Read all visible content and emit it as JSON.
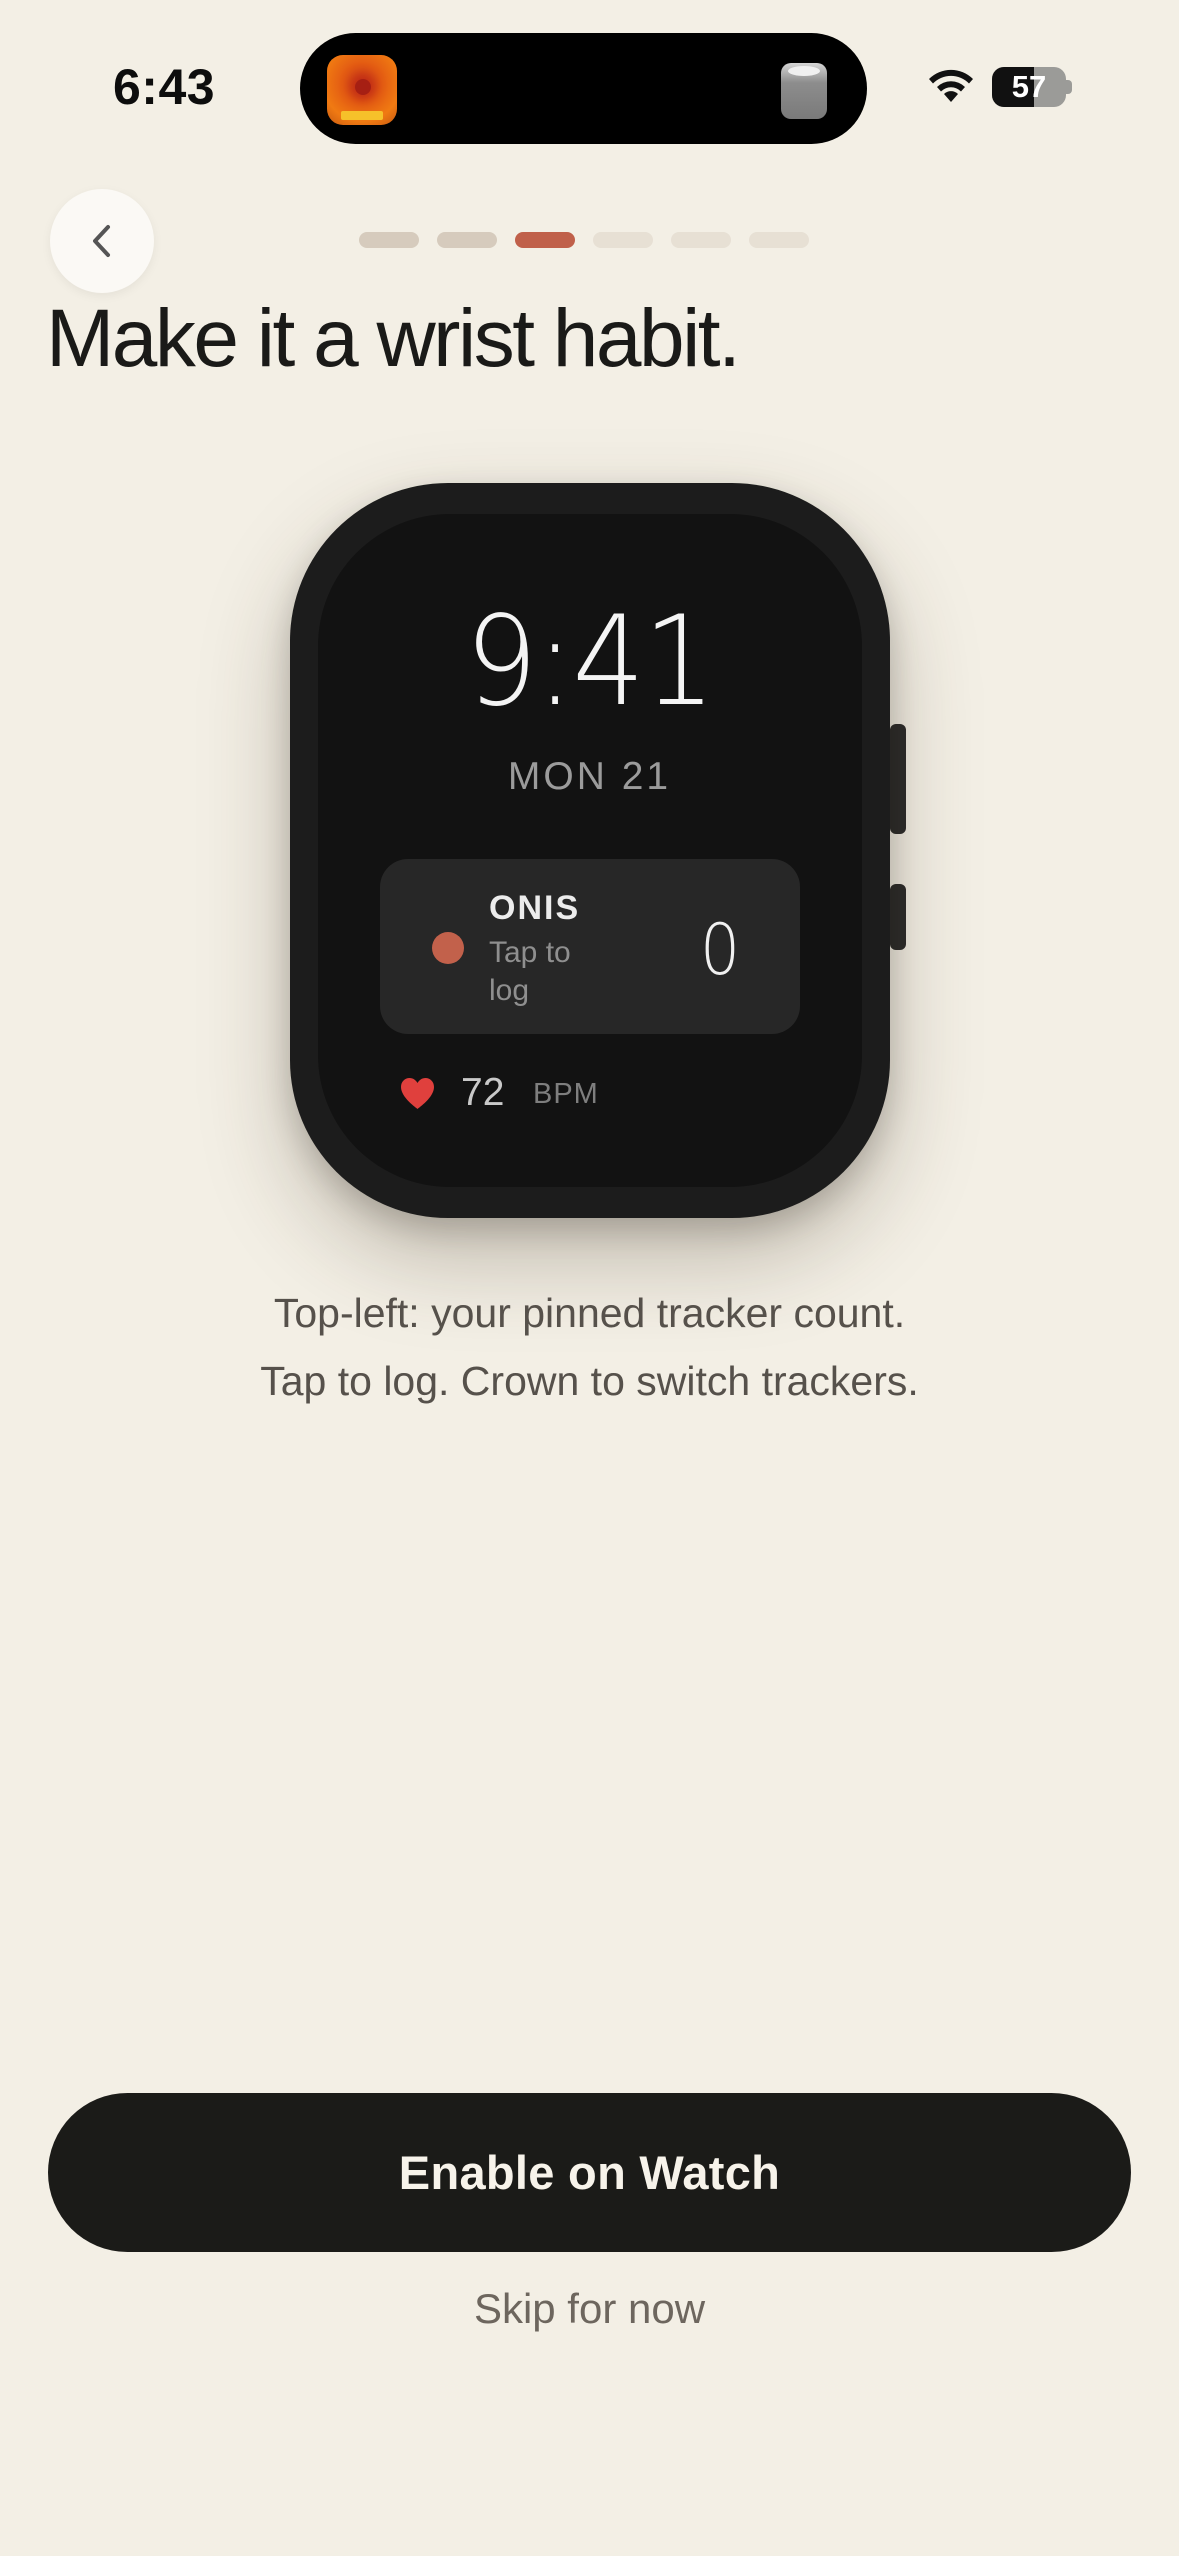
{
  "status_bar": {
    "time": "6:43",
    "battery_percent": "57",
    "battery_level": 0.57
  },
  "onboarding": {
    "total_steps": 6,
    "current_step": 3
  },
  "header": {
    "title": "Make it a wrist habit."
  },
  "watch": {
    "time": "9:41",
    "date": "MON 21",
    "complication": {
      "name": "ONIS",
      "hint": "Tap to log",
      "count": "0",
      "accent_color": "#c2614b"
    },
    "heart_rate": {
      "value": "72",
      "unit": "BPM",
      "icon": "heart-icon",
      "color": "#e0403d"
    }
  },
  "caption": {
    "line1": "Top-left: your pinned tracker count.",
    "line2": "Tap to log. Crown to switch trackers."
  },
  "actions": {
    "primary_label": "Enable on Watch",
    "secondary_label": "Skip for now"
  },
  "colors": {
    "background": "#F3EFE5",
    "accent": "#c0604a",
    "primary_button": "#1b1b18"
  }
}
